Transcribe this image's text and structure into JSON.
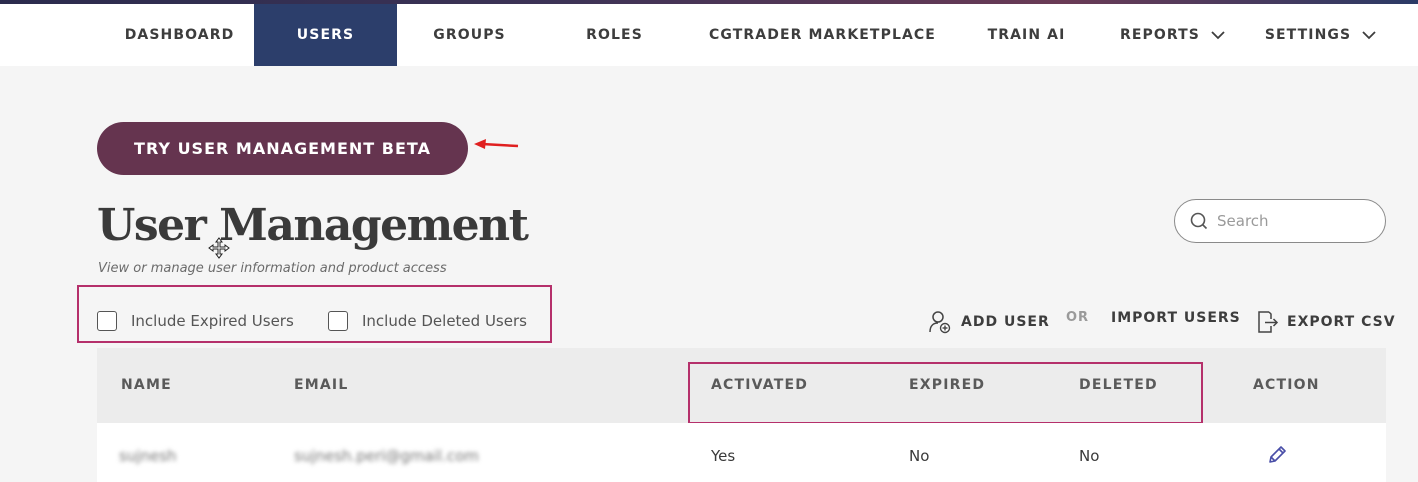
{
  "nav": {
    "items": [
      {
        "label": "DASHBOARD"
      },
      {
        "label": "USERS"
      },
      {
        "label": "GROUPS"
      },
      {
        "label": "ROLES"
      },
      {
        "label": "CGTRADER MARKETPLACE"
      },
      {
        "label": "TRAIN AI"
      },
      {
        "label": "REPORTS"
      },
      {
        "label": "SETTINGS"
      }
    ],
    "active": "USERS"
  },
  "beta_button": {
    "label": "TRY USER MANAGEMENT BETA"
  },
  "header": {
    "title": "User Management",
    "subtitle": "View or manage user information and product access"
  },
  "search": {
    "placeholder": "Search"
  },
  "filters": {
    "expired": {
      "label": "Include Expired Users",
      "checked": false
    },
    "deleted": {
      "label": "Include Deleted Users",
      "checked": false
    }
  },
  "actions": {
    "add_user": "ADD USER",
    "or": "OR",
    "import_users": "IMPORT USERS",
    "export_csv": "EXPORT CSV"
  },
  "table": {
    "columns": [
      "NAME",
      "EMAIL",
      "ACTIVATED",
      "EXPIRED",
      "DELETED",
      "ACTION"
    ],
    "rows": [
      {
        "name": "sujnesh",
        "email": "sujnesh.peri@gmail.com",
        "activated": "Yes",
        "expired": "No",
        "deleted": "No"
      }
    ]
  },
  "colors": {
    "accent_nav": "#2c3e6b",
    "beta_button": "#65344f",
    "highlight_box": "#b5306b",
    "annotation_arrow": "#e02020",
    "edit_icon": "#4a4fa8"
  },
  "icons": {
    "search": "search-icon",
    "add_user": "add-user-icon",
    "export": "export-icon",
    "edit": "pencil-icon",
    "dropdown": "chevron-down-icon"
  }
}
